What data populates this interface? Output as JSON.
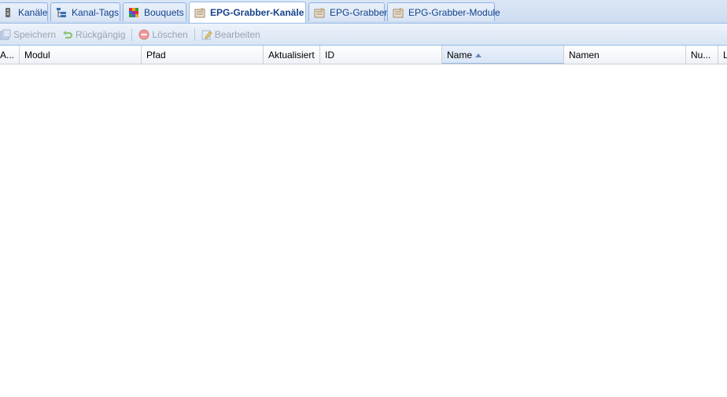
{
  "tabs": [
    {
      "label": "Kanäle",
      "icon": "remote-icon"
    },
    {
      "label": "Kanal-Tags",
      "icon": "tag-tree-icon"
    },
    {
      "label": "Bouquets",
      "icon": "color-grid-icon"
    },
    {
      "label": "EPG-Grabber-Kanäle",
      "icon": "grabber-icon"
    },
    {
      "label": "EPG-Grabber",
      "icon": "grabber-icon"
    },
    {
      "label": "EPG-Grabber-Module",
      "icon": "grabber-icon"
    }
  ],
  "active_tab": "EPG-Grabber-Kanäle",
  "toolbar": {
    "save": "Speichern",
    "undo": "Rückgängig",
    "delete": "Löschen",
    "edit": "Bearbeiten"
  },
  "grid": {
    "columns": [
      "A...",
      "Modul",
      "Pfad",
      "Aktualisiert",
      "ID",
      "Name",
      "Namen",
      "Nu...",
      "L"
    ],
    "sorted_column": "Name",
    "sort_direction": "ascending"
  },
  "colors": {
    "accent": "#15428b",
    "border": "#99bbe8",
    "disabled_text": "#9aa4b1"
  }
}
